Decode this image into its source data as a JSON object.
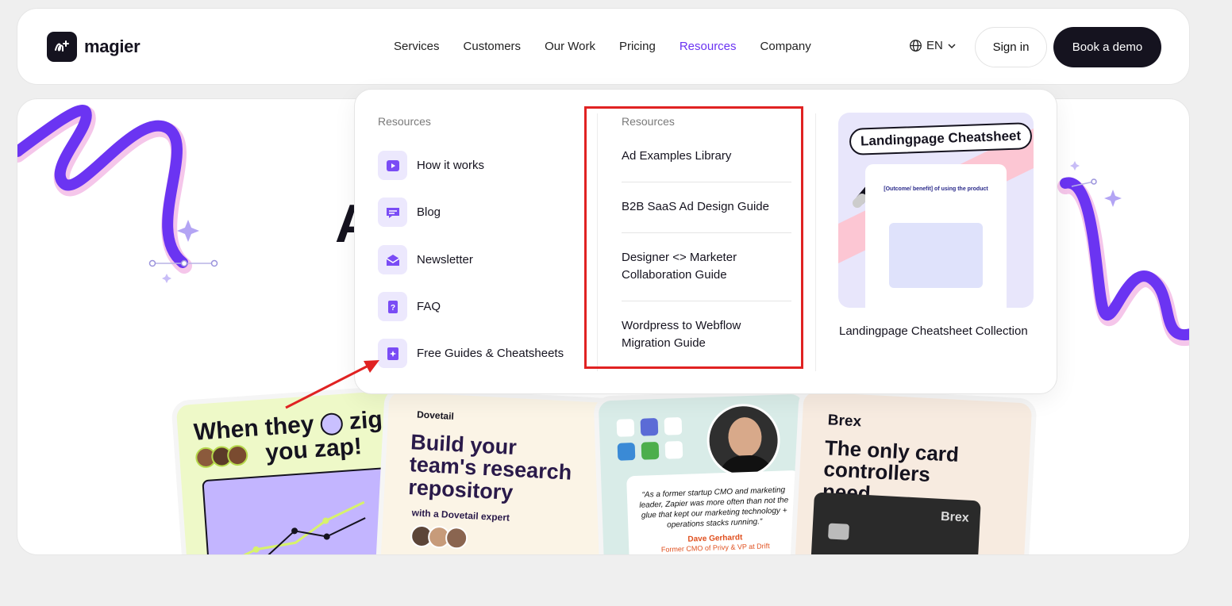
{
  "brand": {
    "name": "magier"
  },
  "nav": {
    "items": [
      "Services",
      "Customers",
      "Our Work",
      "Pricing",
      "Resources",
      "Company"
    ],
    "active": "Resources"
  },
  "header": {
    "lang": "EN",
    "signin": "Sign in",
    "demo": "Book a demo"
  },
  "hero": {
    "title_fragment": "A"
  },
  "cards": {
    "c1": {
      "title_a": "When they",
      "title_b": "zig",
      "title_c": "you zap!"
    },
    "c2": {
      "brand": "Dovetail",
      "title": "Build your team's research repository",
      "sub": "with a Dovetail expert"
    },
    "c3": {
      "quote": "“As a former startup CMO and marketing leader, Zapier was more often than not the glue that kept our marketing technology + operations stacks running.”",
      "name": "Dave Gerhardt",
      "role": "Former CMO of Privy & VP at Drift"
    },
    "c4": {
      "brand": "Brex",
      "title": "The only card controllers need.",
      "card_brand": "Brex"
    }
  },
  "dropdown": {
    "col1_title": "Resources",
    "col1_items": [
      {
        "label": "How it works",
        "icon": "play-icon"
      },
      {
        "label": "Blog",
        "icon": "chat-icon"
      },
      {
        "label": "Newsletter",
        "icon": "mail-icon"
      },
      {
        "label": "FAQ",
        "icon": "question-icon"
      },
      {
        "label": "Free Guides & Cheatsheets",
        "icon": "sparkle-book-icon"
      }
    ],
    "col2_title": "Resources",
    "col2_items": [
      "Ad Examples Library",
      "B2B SaaS Ad Design Guide",
      "Designer <> Marketer Collaboration Guide",
      "Wordpress to Webflow Migration Guide"
    ],
    "promo": {
      "badge": "Landingpage Cheatsheet",
      "caption": "Landingpage Cheatsheet Collection",
      "mock_title": "[Outcome/ benefit] of using the product"
    }
  },
  "colors": {
    "accent": "#6b34f2",
    "dark": "#15131f",
    "highlight": "#e02222"
  }
}
